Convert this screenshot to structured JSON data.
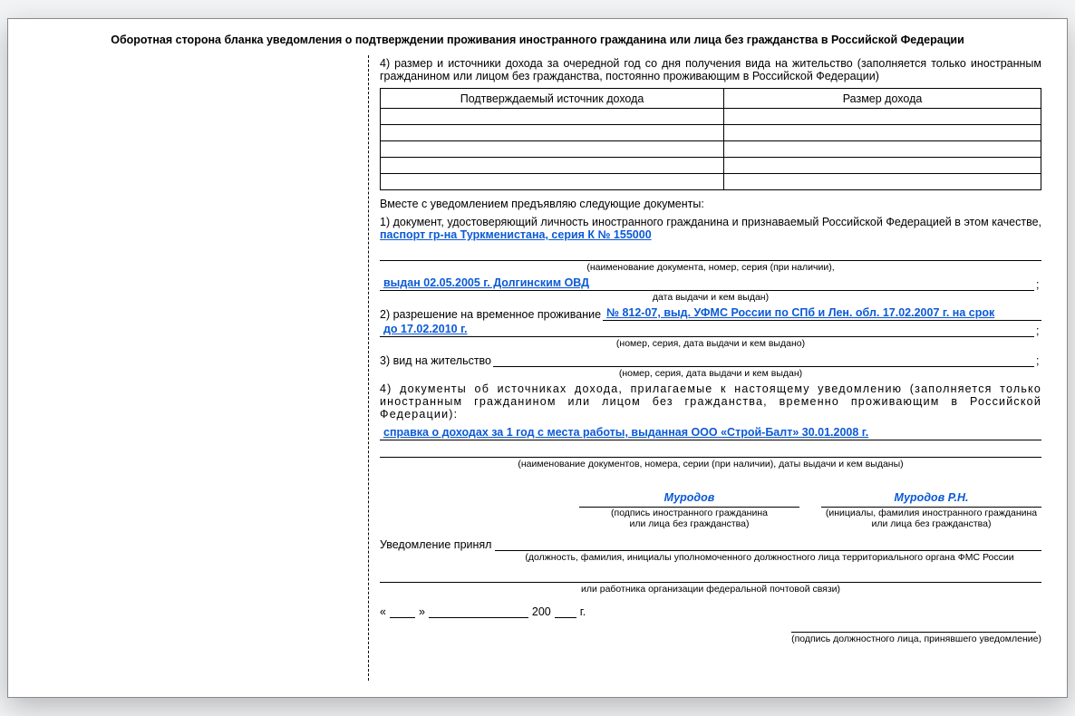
{
  "header": "Оборотная сторона бланка уведомления о подтверждении проживания иностранного гражданина или лица без гражданства в Российской Федерации",
  "item4_text": "4) размер и источники дохода за очередной год со дня получения вида на жительство (заполняется только иностранным гражданином или лицом без гражданства, постоянно проживающим в Российской Федерации)",
  "table": {
    "col1": "Подтверждаемый источник дохода",
    "col2": "Размер дохода"
  },
  "docs_intro": "Вместе с уведомлением предъявляю следующие документы:",
  "doc1_lead": "1) документ, удостоверяющий личность иностранного гражданина и признаваемый Российской Федерацией в этом качестве,",
  "doc1_val": " паспорт гр-на Туркменистана, серия К № 155000",
  "doc1_hint": "(наименование документа, номер, серия (при наличии),",
  "doc1_issued_label": "выдан  02.05.2005 г. Долгинским ОВД",
  "doc1_issued_hint": "дата выдачи и кем выдан)",
  "doc2_lead": "2) разрешение на временное проживание ",
  "doc2_val": " № 812-07, выд. УФМС России по СПб и Лен. обл. 17.02.2007 г. на срок",
  "doc2_val_line2": "до 17.02.2010 г.",
  "doc2_hint": "(номер, серия, дата выдачи и кем выдано)",
  "doc3_lead": "3) вид на жительство",
  "doc3_hint": "(номер, серия, дата выдачи и кем выдан)",
  "doc4_text": "4) документы об источниках дохода, прилагаемые к настоящему уведомлению (заполняется только иностранным гражданином или лицом без гражданства, временно проживающим в Российской Федерации):",
  "doc4_val": "справка о доходах за 1 год с места работы, выданная ООО «Строй-Балт» 30.01.2008 г.",
  "doc4_hint": "(наименование документов, номера, серии (при наличии), даты выдачи и кем выданы)",
  "sig_value": "Муродов",
  "sig_cap1_l1": "(подпись иностранного гражданина",
  "sig_cap1_l2": "или лица без гражданства)",
  "sig2_value": "Муродов Р.Н.",
  "sig_cap2_l1": "(инициалы, фамилия иностранного гражданина",
  "sig_cap2_l2": "или лица без гражданства)",
  "accept_label": "Уведомление принял",
  "accept_hint": "(должность, фамилия, инициалы уполномоченного должностного лица территориального органа ФМС России",
  "accept_hint2": "или работника организации федеральной почтовой связи)",
  "date_year_prefix": "200",
  "date_year_suffix": " г.",
  "official_sig_hint": "(подпись должностного лица, принявшего уведомление)",
  "quote_open": "«",
  "quote_close": "»"
}
